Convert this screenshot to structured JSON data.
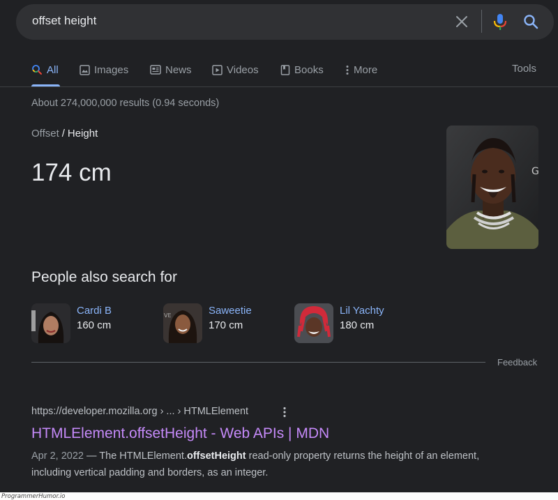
{
  "search": {
    "query": "offset height"
  },
  "tabs": [
    {
      "label": "All",
      "icon": "search-icon",
      "active": true
    },
    {
      "label": "Images",
      "icon": "image-icon"
    },
    {
      "label": "News",
      "icon": "news-icon"
    },
    {
      "label": "Videos",
      "icon": "video-icon"
    },
    {
      "label": "Books",
      "icon": "book-icon"
    },
    {
      "label": "More",
      "icon": "more-vert-icon"
    }
  ],
  "tools_label": "Tools",
  "result_stats": "About 274,000,000 results (0.94 seconds)",
  "knowledge": {
    "breadcrumb_parent": "Offset",
    "breadcrumb_separator": "/",
    "breadcrumb_current": "Height",
    "answer": "174 cm"
  },
  "people_also_search": {
    "title": "People also search for",
    "people": [
      {
        "name": "Cardi B",
        "height": "160 cm"
      },
      {
        "name": "Saweetie",
        "height": "170 cm"
      },
      {
        "name": "Lil Yachty",
        "height": "180 cm"
      }
    ]
  },
  "feedback_label": "Feedback",
  "result": {
    "url": "https://developer.mozilla.org › ... › HTMLElement",
    "title": "HTMLElement.offsetHeight - Web APIs | MDN",
    "date": "Apr 2, 2022",
    "snippet_prefix": " — The HTMLElement.",
    "snippet_bold": "offsetHeight",
    "snippet_suffix": " read-only property returns the height of an element, including vertical padding and borders, as an integer."
  },
  "watermark": "ProgrammerHumor.io",
  "colors": {
    "background": "#202124",
    "link": "#8ab4f8",
    "visited_title": "#c58af9",
    "muted_text": "#9aa0a6"
  }
}
